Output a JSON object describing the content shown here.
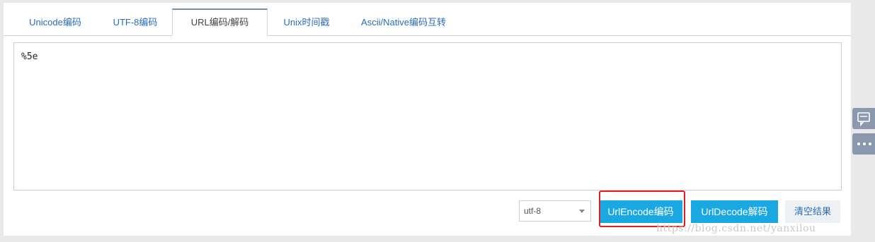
{
  "tabs": [
    {
      "label": "Unicode编码"
    },
    {
      "label": "UTF-8编码"
    },
    {
      "label": "URL编码/解码"
    },
    {
      "label": "Unix时间戳"
    },
    {
      "label": "Ascii/Native编码互转"
    }
  ],
  "active_tab": "URL编码/解码",
  "input": {
    "value": "%5e"
  },
  "encoding_select": {
    "value": "utf-8"
  },
  "buttons": {
    "encode": "UrlEncode编码",
    "decode": "UrlDecode解码",
    "clear": "清空结果"
  },
  "watermark": "https://blog.csdn.net/yanxilou",
  "side_icons": [
    "comment-icon",
    "more-icon"
  ],
  "colors": {
    "primary_button": "#19a8e2",
    "tab_text": "#2a6db4",
    "highlight_box": "#e02020",
    "side_button": "#8a99ad"
  }
}
